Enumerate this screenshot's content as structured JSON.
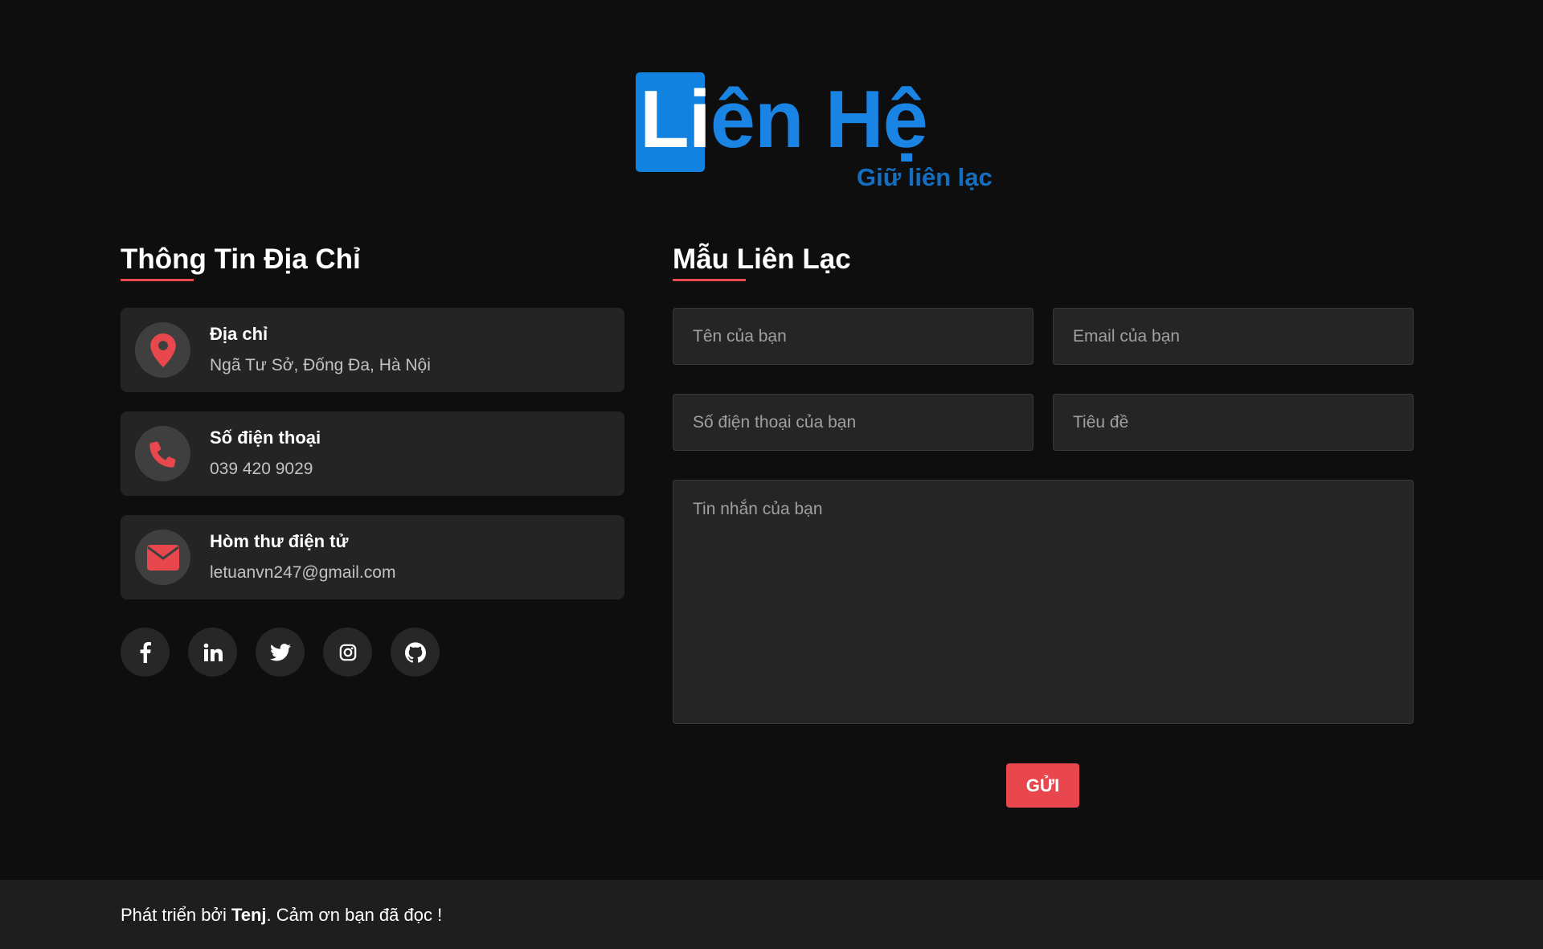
{
  "hero": {
    "title_first": "Li",
    "title_rest": "ên Hệ",
    "subtitle": "Giữ liên lạc"
  },
  "address_section": {
    "title": "Thông Tin Địa Chỉ",
    "items": [
      {
        "icon": "map-marker-icon",
        "label": "Địa chỉ",
        "value": "Ngã Tư Sở, Đống Đa, Hà Nội"
      },
      {
        "icon": "phone-icon",
        "label": "Số điện thoại",
        "value": "039 420 9029"
      },
      {
        "icon": "envelope-icon",
        "label": "Hòm thư điện tử",
        "value": "letuanvn247@gmail.com"
      }
    ],
    "social": [
      "facebook-icon",
      "linkedin-icon",
      "twitter-icon",
      "instagram-icon",
      "github-icon"
    ]
  },
  "contact_form": {
    "title": "Mẫu Liên Lạc",
    "name_placeholder": "Tên của bạn",
    "email_placeholder": "Email của bạn",
    "phone_placeholder": "Số điện thoại của bạn",
    "subject_placeholder": "Tiêu đề",
    "message_placeholder": "Tin nhắn của bạn",
    "submit_label": "GỬI"
  },
  "footer": {
    "prefix": "Phát triển bởi ",
    "author": "Tenj",
    "suffix": ". Cảm ơn bạn đã đọc !"
  },
  "colors": {
    "background": "#0e0e0e",
    "card": "#242424",
    "accent_red": "#e8474d",
    "accent_blue": "#1a84e4"
  }
}
